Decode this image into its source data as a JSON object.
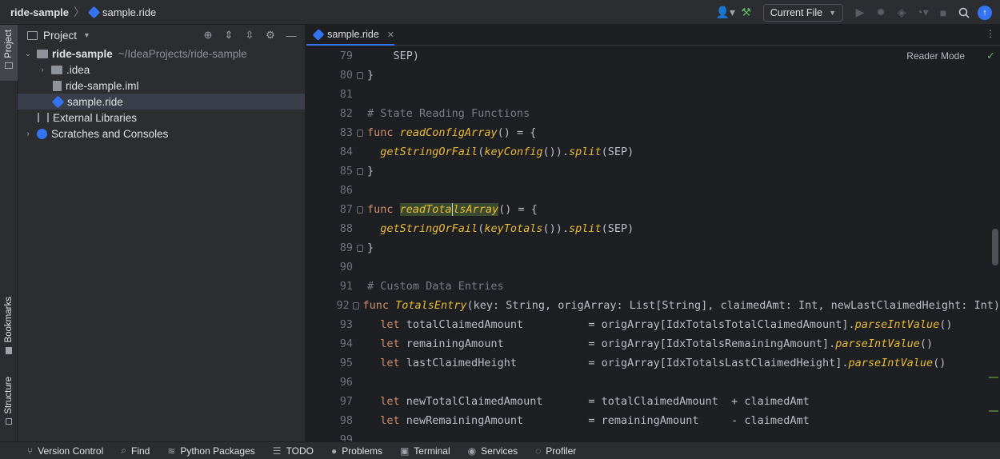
{
  "titlebar": {
    "project": "ride-sample",
    "file": "sample.ride",
    "run_config": "Current File"
  },
  "left_strip": {
    "project": "Project",
    "bookmarks": "Bookmarks",
    "structure": "Structure"
  },
  "project_panel": {
    "title": "Project",
    "tree": [
      {
        "label": "ride-sample",
        "path": "~/IdeaProjects/ride-sample"
      },
      {
        "label": ".idea"
      },
      {
        "label": "ride-sample.iml"
      },
      {
        "label": "sample.ride"
      },
      {
        "label": "External Libraries"
      },
      {
        "label": "Scratches and Consoles"
      }
    ]
  },
  "editor": {
    "tab_label": "sample.ride",
    "reader_mode": "Reader Mode",
    "line_numbers": [
      "79",
      "80",
      "81",
      "82",
      "83",
      "84",
      "85",
      "86",
      "87",
      "88",
      "89",
      "90",
      "91",
      "92",
      "93",
      "94",
      "95",
      "96",
      "97",
      "98",
      "99"
    ]
  },
  "bottombar": {
    "items": [
      "Version Control",
      "Find",
      "Python Packages",
      "TODO",
      "Problems",
      "Terminal",
      "Services",
      "Profiler"
    ]
  },
  "colors": {
    "accent": "#3574f0",
    "keyword": "#cf8e6d",
    "function": "#e8ba36",
    "comment": "#7a7e85"
  }
}
